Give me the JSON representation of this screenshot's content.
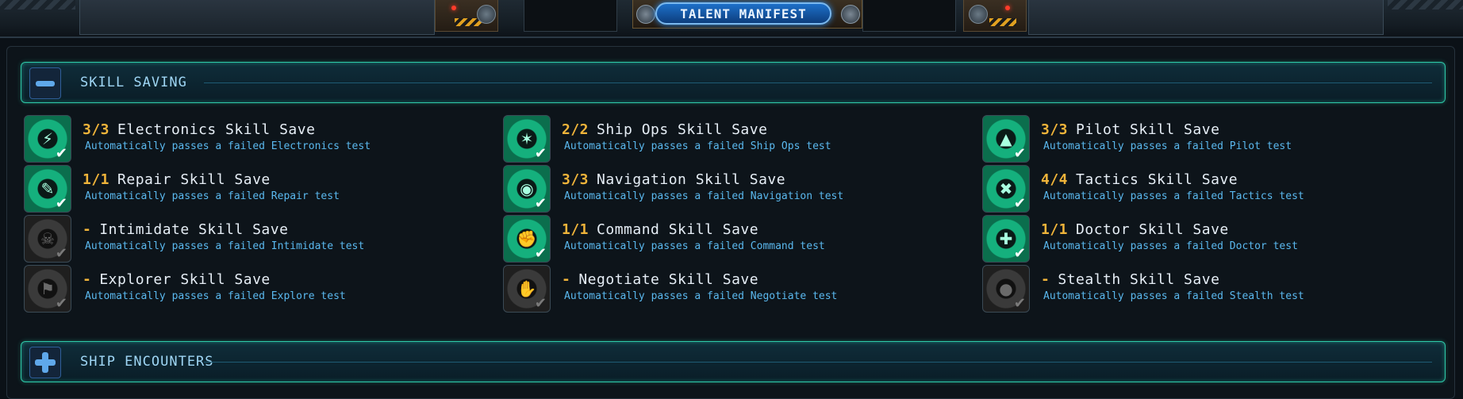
{
  "window": {
    "title": "TALENT MANIFEST"
  },
  "sections": [
    {
      "title": "SKILL SAVING",
      "toggle": "minus",
      "expanded": true
    },
    {
      "title": "SHIP ENCOUNTERS",
      "toggle": "plus",
      "expanded": false
    }
  ],
  "skills": [
    {
      "count": "3/3",
      "name": "Electronics Skill Save",
      "desc": "Automatically passes a failed Electronics test",
      "icon": "lightning-icon",
      "active": true
    },
    {
      "count": "1/1",
      "name": "Repair Skill Save",
      "desc": "Automatically passes a failed Repair test",
      "icon": "wrench-icon",
      "active": true
    },
    {
      "count": "-",
      "name": "Intimidate Skill Save",
      "desc": "Automatically passes a failed Intimidate test",
      "icon": "skull-icon",
      "active": false
    },
    {
      "count": "-",
      "name": "Explorer Skill Save",
      "desc": "Automatically passes a failed Explore test",
      "icon": "flag-icon",
      "active": false
    },
    {
      "count": "2/2",
      "name": "Ship Ops Skill Save",
      "desc": "Automatically passes a failed Ship Ops test",
      "icon": "stars-icon",
      "active": true
    },
    {
      "count": "3/3",
      "name": "Navigation Skill Save",
      "desc": "Automatically passes a failed Navigation test",
      "icon": "compass-icon",
      "active": true
    },
    {
      "count": "1/1",
      "name": "Command Skill Save",
      "desc": "Automatically passes a failed Command test",
      "icon": "command-icon",
      "active": true
    },
    {
      "count": "-",
      "name": "Negotiate Skill Save",
      "desc": "Automatically passes a failed Negotiate test",
      "icon": "handshake-icon",
      "active": false
    },
    {
      "count": "3/3",
      "name": "Pilot Skill Save",
      "desc": "Automatically passes a failed Pilot test",
      "icon": "ship-icon",
      "active": true
    },
    {
      "count": "4/4",
      "name": "Tactics Skill Save",
      "desc": "Automatically passes a failed Tactics test",
      "icon": "tactics-icon",
      "active": true
    },
    {
      "count": "1/1",
      "name": "Doctor Skill Save",
      "desc": "Automatically passes a failed Doctor test",
      "icon": "medical-cross-icon",
      "active": true
    },
    {
      "count": "-",
      "name": "Stealth Skill Save",
      "desc": "Automatically passes a failed Stealth test",
      "icon": "hood-icon",
      "active": false
    }
  ],
  "colors": {
    "count": "#f0b43a",
    "description": "#5ab8ee",
    "accent": "#2ec9a8",
    "active_icon": "#15b07d"
  }
}
